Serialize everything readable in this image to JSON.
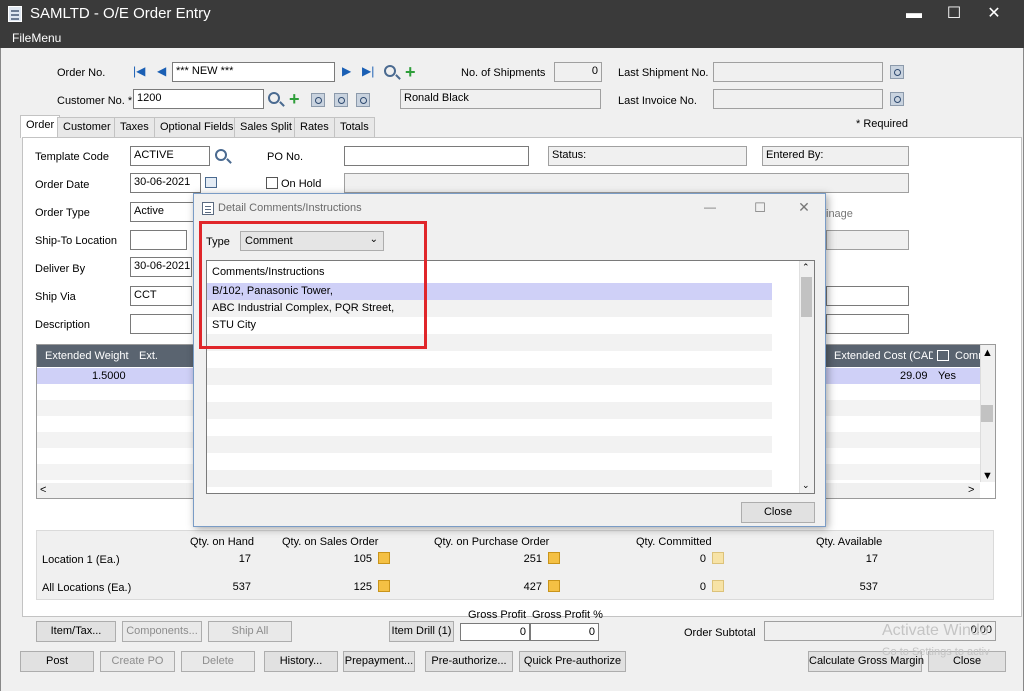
{
  "window": {
    "title": "SAMLTD - O/E Order Entry",
    "minimize": "▬",
    "maximize": "☐",
    "close": "✕"
  },
  "menu": {
    "file_menu": "FileMenu"
  },
  "header": {
    "order_no_label": "Order No.",
    "order_no_value": "*** NEW ***",
    "customer_no_label": "Customer No. *",
    "customer_no_value": "1200",
    "customer_name": "Ronald Black",
    "shipments_label": "No. of Shipments",
    "shipments_value": "0",
    "last_shipment_label": "Last Shipment No.",
    "last_invoice_label": "Last Invoice No.",
    "required_note": "*  Required"
  },
  "tabs": [
    "Order",
    "Customer",
    "Taxes",
    "Optional Fields",
    "Sales Split",
    "Rates",
    "Totals"
  ],
  "order_tab": {
    "template_code_label": "Template Code",
    "template_code_value": "ACTIVE",
    "po_no_label": "PO No.",
    "status_label": "Status:",
    "entered_by_label": "Entered By:",
    "order_date_label": "Order Date",
    "order_date_value": "30-06-2021",
    "on_hold_label": "On Hold",
    "order_type_label": "Order Type",
    "order_type_value": "Active",
    "retainage_label": "inage",
    "ship_to_label": "Ship-To Location",
    "deliver_by_label": "Deliver By",
    "deliver_by_value": "30-06-2021",
    "ship_via_label": "Ship Via",
    "ship_via_value": "CCT",
    "description_label": "Description"
  },
  "grid": {
    "col_ext_weight": "Extended Weight",
    "col_ext_partial": "Ext.",
    "col_ext_cost": "Extended Cost (CAD)",
    "col_comments": "Comm",
    "row1_weight": "1.5000",
    "row1_cost": "29.09",
    "row1_comments": "Yes"
  },
  "quantities": {
    "headers": [
      "Qty. on Hand",
      "Qty. on Sales Order",
      "Qty. on Purchase Order",
      "Qty. Committed",
      "Qty. Available"
    ],
    "rows": [
      {
        "label": "Location  1 (Ea.)",
        "values": [
          "17",
          "105",
          "251",
          "0",
          "17"
        ]
      },
      {
        "label": "All Locations (Ea.)",
        "values": [
          "537",
          "125",
          "427",
          "0",
          "537"
        ]
      }
    ]
  },
  "item_buttons": {
    "item_tax": "Item/Tax...",
    "components": "Components...",
    "ship_all": "Ship All",
    "item_drill": "Item Drill (1)"
  },
  "totals": {
    "gross_profit_label": "Gross Profit",
    "gross_profit_pct_label": "Gross Profit %",
    "gross_profit_value": "0",
    "gross_profit_pct_value": "0",
    "order_subtotal_label": "Order Subtotal",
    "order_subtotal_value": "0.00"
  },
  "bottom_buttons": {
    "post": "Post",
    "create_po": "Create PO",
    "delete": "Delete",
    "history": "History...",
    "prepayment": "Prepayment...",
    "preauthorize": "Pre-authorize...",
    "quick_preauthorize": "Quick Pre-authorize",
    "calc_gross_margin": "Calculate Gross Margin",
    "close": "Close"
  },
  "dialog": {
    "title": "Detail Comments/Instructions",
    "type_label": "Type",
    "type_value": "Comment",
    "list_header": "Comments/Instructions",
    "lines": [
      "B/102, Panasonic Tower,",
      "ABC Industrial Complex, PQR Street,",
      "STU City"
    ],
    "close_button": "Close"
  },
  "watermark": {
    "line1": "Activate Windo",
    "line2": "Go to Settings to activ"
  },
  "colors": {
    "highlight": "#cfd0f7",
    "grid_header": "#5a6470",
    "annotation": "#e0262a"
  }
}
